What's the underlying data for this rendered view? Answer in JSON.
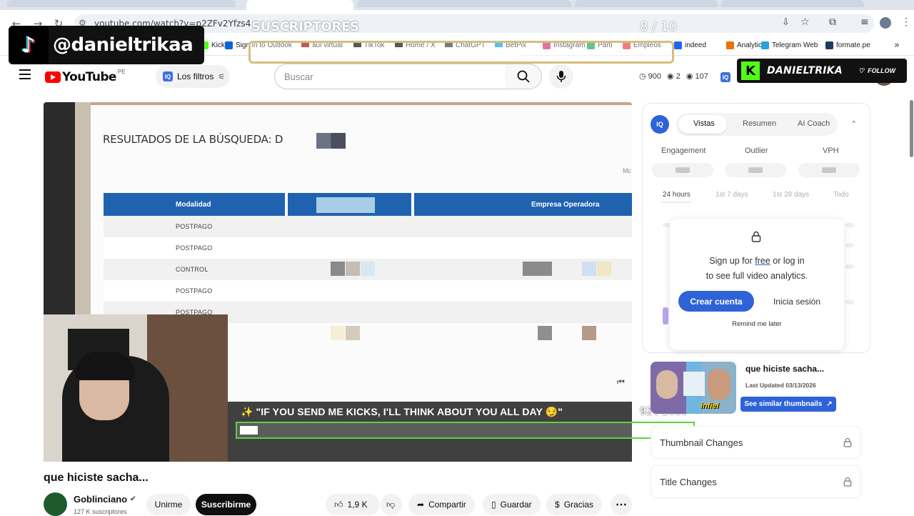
{
  "browser": {
    "url": "youtube.com/watch?v=p2ZFv2Yfzs4",
    "bookmarks": [
      {
        "label": "Kick",
        "color": "#53fc18"
      },
      {
        "label": "Sign in to Outlook",
        "color": "#0a64d6"
      },
      {
        "label": "aul virtual",
        "color": "#a00000"
      },
      {
        "label": "TikTok",
        "color": "#000000"
      },
      {
        "label": "Home / X",
        "color": "#000000"
      },
      {
        "label": "ChatGPT",
        "color": "#333333"
      },
      {
        "label": "BetPix",
        "color": "#00a0e0"
      },
      {
        "label": "Instagram",
        "color": "#d62976"
      },
      {
        "label": "Parti",
        "color": "#16a34a"
      },
      {
        "label": "Empleos",
        "color": "#e53935"
      },
      {
        "label": "indeed",
        "color": "#2164f3"
      },
      {
        "label": "Analytics",
        "color": "#e8710a"
      },
      {
        "label": "Telegram Web",
        "color": "#2aa1da"
      },
      {
        "label": "formate.pe",
        "color": "#1e3a5f"
      }
    ]
  },
  "overlay": {
    "tiktok_handle": "@danieltrikaa",
    "subs_label": "SUSCRIPTORES",
    "subs_count": "8 / 10",
    "subs_progress": 0.8,
    "kick_name": "DANIELTRIKA",
    "kick_follow": "FOLLOW",
    "kicks_message": "✨ \"IF YOU SEND ME KICKS, I'LL THINK ABOUT YOU ALL DAY 😏\"",
    "kicks_goal": "92 / 2000",
    "kicks_progress": 0.046
  },
  "youtube": {
    "logo": "YouTube",
    "country": "PE",
    "filters_label": "Los filtros",
    "search_placeholder": "Buscar",
    "stats": {
      "views": "900",
      "watching": "2",
      "other": "107"
    }
  },
  "video": {
    "doc_title": "RESULTADOS DE LA BÚSQUEDA: D",
    "col1": "Modalidad",
    "col2": "Empresa Operadora",
    "side_text": "Mc",
    "rows": [
      "POSTPAGO",
      "POSTPAGO",
      "CONTROL",
      "POSTPAGO",
      "POSTPAGO"
    ]
  },
  "panel": {
    "tabs": [
      "Vistas",
      "Resumen",
      "AI Coach"
    ],
    "metrics": [
      "Engagement",
      "Outlier",
      "VPH"
    ],
    "time_tabs": [
      "24 hours",
      "1st 7 days",
      "1st 28 days",
      "Todo"
    ],
    "signup_line1_a": "Sign up for ",
    "signup_line1_free": "free",
    "signup_line1_b": " or log in",
    "signup_line2": "to see full video analytics.",
    "crear": "Crear cuenta",
    "inicia": "Inicia sesión",
    "remind": "Remind me later",
    "thumb_title": "que hiciste sacha...",
    "last_updated": "Last Updated 03/13/2026",
    "similar": "See similar thumbnails",
    "thumb_tag": "infiel",
    "thumbnail_changes": "Thumbnail Changes",
    "title_changes": "Title Changes"
  },
  "below": {
    "title": "que hiciste sacha...",
    "channel": "Goblinciano",
    "subs": "127 K suscriptores",
    "unirme": "Unirme",
    "suscribirme": "Suscribirme",
    "likes": "1,9 K",
    "compartir": "Compartir",
    "guardar": "Guardar",
    "gracias": "Gracias"
  }
}
